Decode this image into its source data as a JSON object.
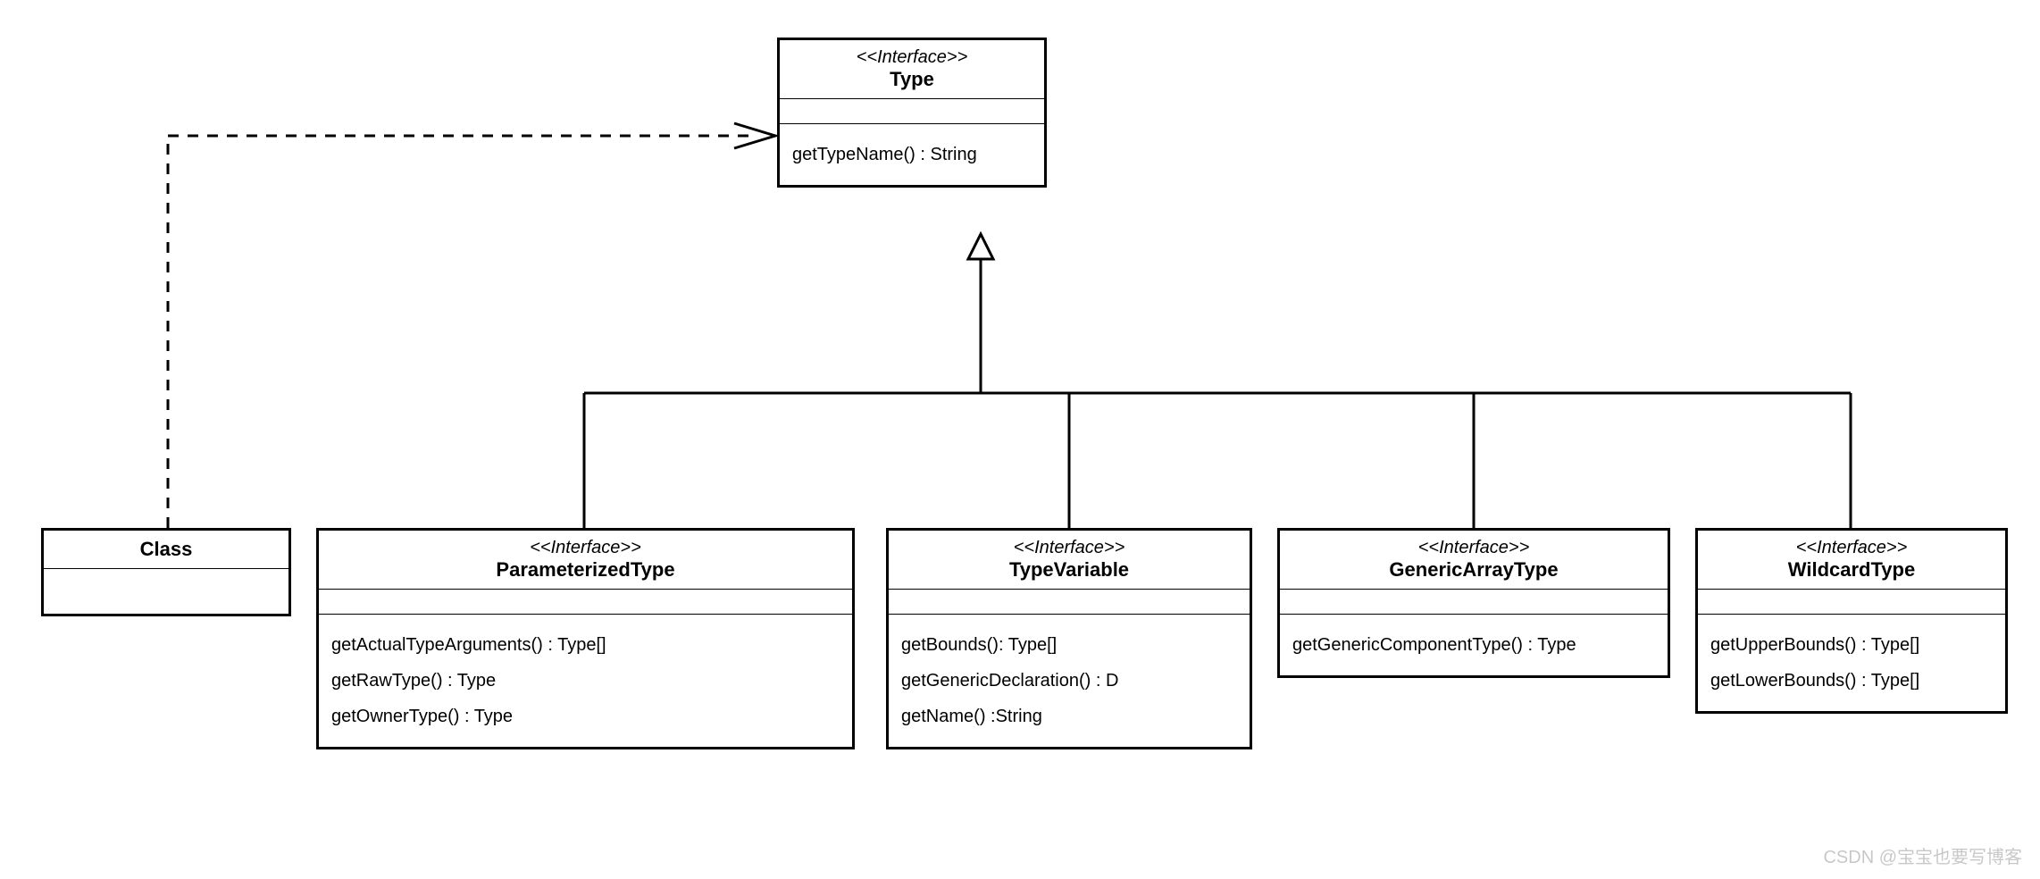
{
  "watermark": "CSDN @宝宝也要写博客",
  "boxes": {
    "type": {
      "stereotype": "<<Interface>>",
      "name": "Type",
      "methods": [
        "getTypeName() : String"
      ]
    },
    "class": {
      "name": "Class"
    },
    "parameterizedType": {
      "stereotype": "<<Interface>>",
      "name": "ParameterizedType",
      "methods": [
        "getActualTypeArguments() : Type[]",
        "getRawType() : Type",
        "getOwnerType() : Type"
      ]
    },
    "typeVariable": {
      "stereotype": "<<Interface>>",
      "name": "TypeVariable",
      "methods": [
        "getBounds(): Type[]",
        "getGenericDeclaration() : D",
        "getName() :String"
      ]
    },
    "genericArrayType": {
      "stereotype": "<<Interface>>",
      "name": "GenericArrayType",
      "methods": [
        "getGenericComponentType() : Type"
      ]
    },
    "wildcardType": {
      "stereotype": "<<Interface>>",
      "name": "WildcardType",
      "methods": [
        "getUpperBounds() : Type[]",
        "getLowerBounds() : Type[]"
      ]
    }
  }
}
